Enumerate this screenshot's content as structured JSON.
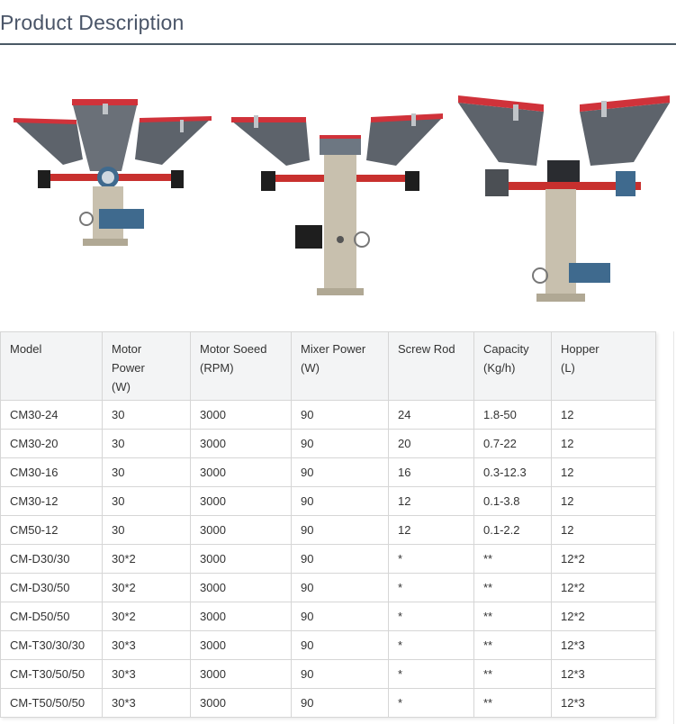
{
  "section": {
    "title": "Product Description"
  },
  "images": [
    {
      "name": "dosing-mixer-three-hopper-photo"
    },
    {
      "name": "dosing-mixer-two-hopper-photo"
    },
    {
      "name": "dosing-mixer-large-two-hopper-photo"
    }
  ],
  "table": {
    "headers": [
      [
        "Model"
      ],
      [
        "Motor",
        "Power",
        "(W)"
      ],
      [
        "Motor Soeed",
        "(RPM)"
      ],
      [
        "Mixer Power",
        "(W)"
      ],
      [
        "Screw Rod"
      ],
      [
        "Capacity",
        "(Kg/h)"
      ],
      [
        "Hopper",
        "(L)"
      ]
    ],
    "rows": [
      [
        "CM30-24",
        "30",
        "3000",
        "90",
        "24",
        "1.8-50",
        "12"
      ],
      [
        "CM30-20",
        "30",
        "3000",
        "90",
        "20",
        "0.7-22",
        "12"
      ],
      [
        "CM30-16",
        "30",
        "3000",
        "90",
        "16",
        "0.3-12.3",
        "12"
      ],
      [
        "CM30-12",
        "30",
        "3000",
        "90",
        "12",
        "0.1-3.8",
        "12"
      ],
      [
        "CM50-12",
        "30",
        "3000",
        "90",
        "12",
        "0.1-2.2",
        "12"
      ],
      [
        "CM-D30/30",
        "30*2",
        "3000",
        "90",
        "*",
        "**",
        "12*2"
      ],
      [
        "CM-D30/50",
        "30*2",
        "3000",
        "90",
        "*",
        "**",
        "12*2"
      ],
      [
        "CM-D50/50",
        "30*2",
        "3000",
        "90",
        "*",
        "**",
        "12*2"
      ],
      [
        "CM-T30/30/30",
        "30*3",
        "3000",
        "90",
        "*",
        "**",
        "12*3"
      ],
      [
        "CM-T30/50/50",
        "30*3",
        "3000",
        "90",
        "*",
        "**",
        "12*3"
      ],
      [
        "CM-T50/50/50",
        "30*3",
        "3000",
        "90",
        "*",
        "**",
        "12*3"
      ]
    ]
  },
  "colors": {
    "hopper_gray": "#5d636b",
    "lid_red": "#d0323a",
    "frame_red": "#c8302e",
    "motor_blue": "#3f6a8e",
    "motor_black": "#1e1e1e",
    "stand_beige": "#c8c0ae",
    "title_rule": "#4a5966",
    "header_bg": "#f3f4f5"
  }
}
